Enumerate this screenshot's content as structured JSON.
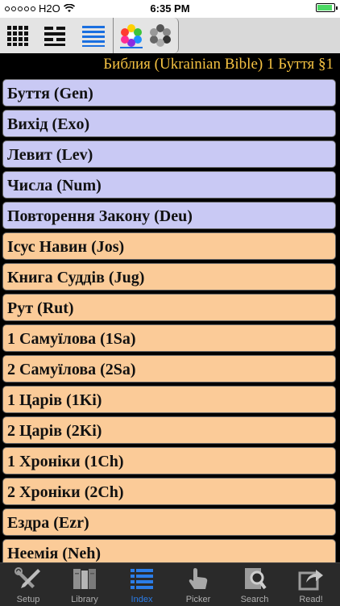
{
  "statusbar": {
    "carrier": "H2O",
    "time": "6:35 PM"
  },
  "toolbar": {
    "buttons": [
      "grid-view-icon",
      "compact-list-icon",
      "list-view-icon",
      "color-wheel-icon",
      "gray-wheel-icon"
    ]
  },
  "header": {
    "title": "Библия (Ukrainian Bible) 1 Буття §1"
  },
  "books": [
    {
      "label": "Буття (Gen)",
      "group": "law"
    },
    {
      "label": "Вихід (Exo)",
      "group": "law"
    },
    {
      "label": "Левит (Lev)",
      "group": "law"
    },
    {
      "label": "Числа (Num)",
      "group": "law"
    },
    {
      "label": "Повторення Закону (Deu)",
      "group": "law"
    },
    {
      "label": "Ісус Навин (Jos)",
      "group": "history"
    },
    {
      "label": "Книга Суддів (Jug)",
      "group": "history"
    },
    {
      "label": "Рут (Rut)",
      "group": "history"
    },
    {
      "label": "1 Самуїлова (1Sa)",
      "group": "history"
    },
    {
      "label": "2 Самуїлова (2Sa)",
      "group": "history"
    },
    {
      "label": "1 Царів (1Ki)",
      "group": "history"
    },
    {
      "label": "2 Царів (2Ki)",
      "group": "history"
    },
    {
      "label": "1 Хроніки (1Ch)",
      "group": "history"
    },
    {
      "label": "2 Хроніки (2Ch)",
      "group": "history"
    },
    {
      "label": "Ездра (Ezr)",
      "group": "history"
    },
    {
      "label": "Неемія (Neh)",
      "group": "history"
    }
  ],
  "tabs": [
    {
      "label": "Setup",
      "icon": "tools-icon"
    },
    {
      "label": "Library",
      "icon": "books-icon"
    },
    {
      "label": "Index",
      "icon": "index-list-icon",
      "active": true
    },
    {
      "label": "Picker",
      "icon": "hand-pointer-icon"
    },
    {
      "label": "Search",
      "icon": "magnifier-icon"
    },
    {
      "label": "Read!",
      "icon": "share-arrow-icon"
    }
  ],
  "colors": {
    "law_row": "#c9c9f4",
    "history_row": "#fbcb98",
    "title_text": "#f5c242",
    "active_tab": "#2b7de9"
  }
}
